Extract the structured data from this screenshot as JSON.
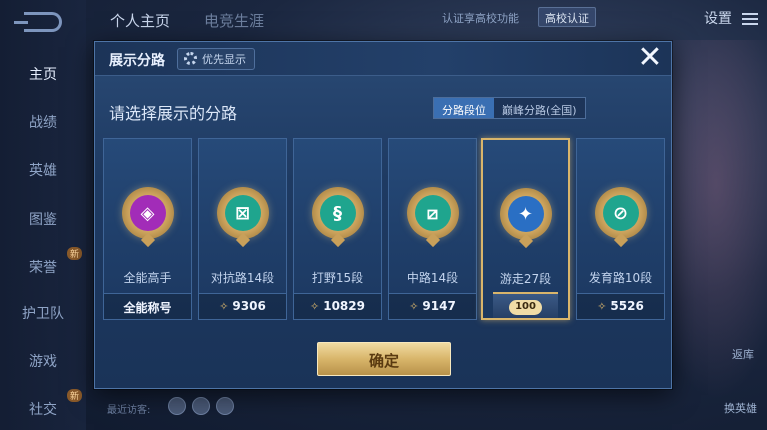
{
  "top_bar": {
    "tabs": [
      "个人主页",
      "电竞生涯"
    ],
    "campus_text": "认证享高校功能",
    "campus_chip": "高校认证",
    "settings_label": "设置"
  },
  "nav": {
    "items": [
      "主页",
      "战绩",
      "英雄",
      "图鉴",
      "荣誉",
      "护卫队",
      "游戏",
      "社交"
    ],
    "badges": {
      "荣誉": "新",
      "社交": "新"
    }
  },
  "background": {
    "recent_visitors_label": "最近访客:",
    "side_labels": [
      "返库",
      "换英雄"
    ]
  },
  "modal": {
    "title": "展示分路",
    "priority_button": "优先显示",
    "subtitle": "请选择展示的分路",
    "segments": [
      "分路段位",
      "巅峰分路(全国)"
    ],
    "active_segment": "分路段位",
    "cards": [
      {
        "icon": "square-diamond-icon",
        "glyph": "◈",
        "color": "#a22cb8",
        "label": "全能高手",
        "footer": "全能称号",
        "points": null
      },
      {
        "icon": "crossed-square-icon",
        "glyph": "⊠",
        "color": "#1fa58e",
        "label": "对抗路14段",
        "footer": null,
        "points": "9306"
      },
      {
        "icon": "dragon-icon",
        "glyph": "🐉",
        "color": "#1fa58e",
        "label": "打野15段",
        "footer": null,
        "points": "10829"
      },
      {
        "icon": "slash-square-icon",
        "glyph": "⧄",
        "color": "#1fa58e",
        "label": "中路14段",
        "footer": null,
        "points": "9147"
      },
      {
        "icon": "wings-icon",
        "glyph": "✦",
        "color": "#2a6fc4",
        "label": "游走27段",
        "footer": null,
        "points": null,
        "rank": "100",
        "selected": true
      },
      {
        "icon": "circle-slash-icon",
        "glyph": "⊘",
        "color": "#1fa58e",
        "label": "发育路10段",
        "footer": null,
        "points": "5526"
      }
    ],
    "confirm_button": "确定"
  },
  "colors": {
    "gold": "#d9b56b",
    "panel": "#1e3a62",
    "accent_blue": "#3a6fb3"
  }
}
